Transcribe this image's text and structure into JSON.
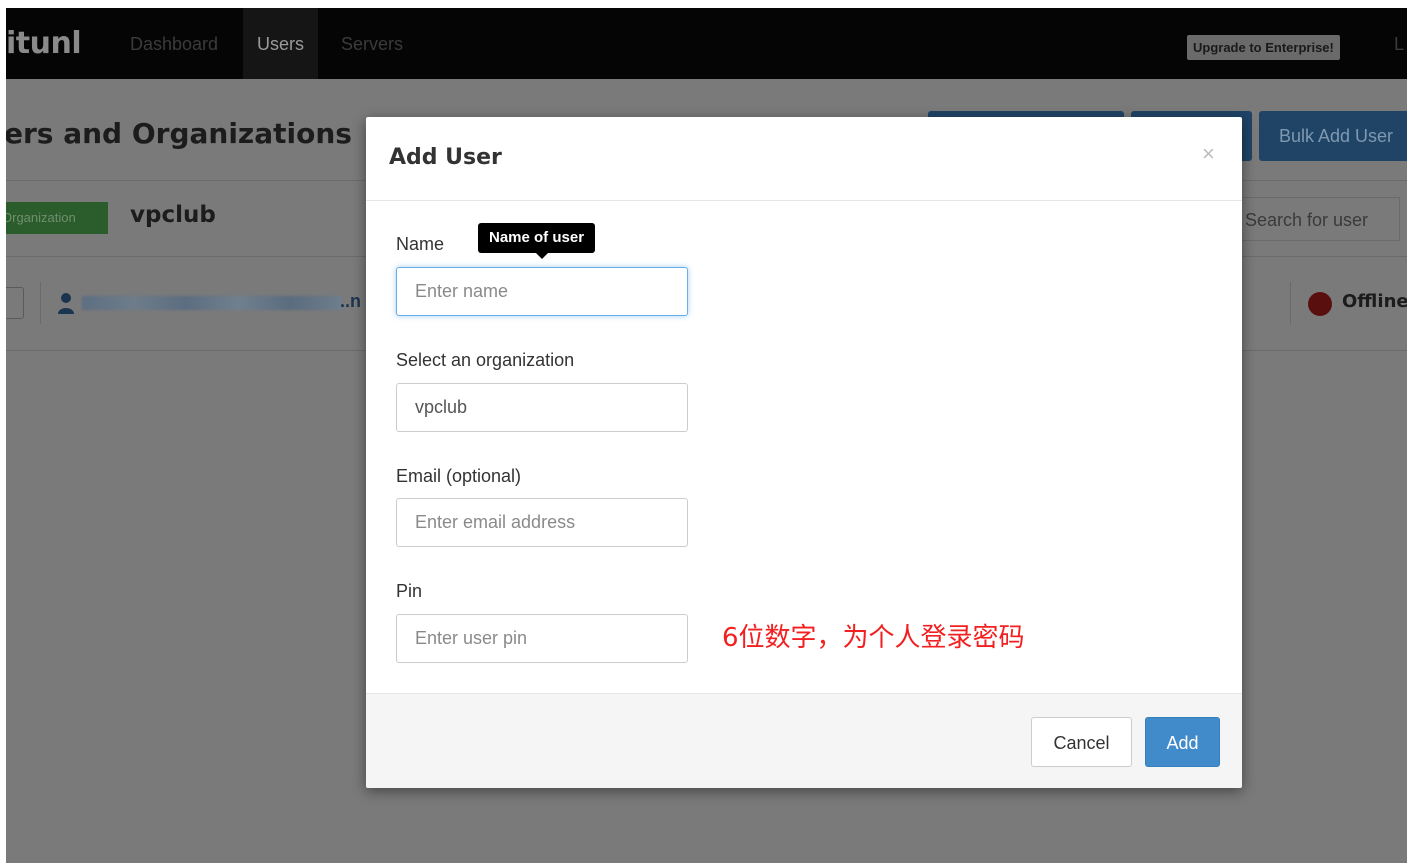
{
  "navbar": {
    "brand": "itunl",
    "links": [
      "Dashboard",
      "Users",
      "Servers"
    ],
    "active": "Users",
    "upgrade_label": "Upgrade to Enterprise!",
    "cut_link": "L"
  },
  "page": {
    "title": "ers and Organizations",
    "bulk_add_label": "Bulk Add User",
    "org_badge": "Organization",
    "org_name": "vpclub",
    "search_placeholder": "Search for user",
    "user_row": {
      "name_tail": "..n",
      "status": "Offline"
    }
  },
  "modal": {
    "title": "Add User",
    "close": "×",
    "tooltip": "Name of user",
    "name": {
      "label": "Name",
      "placeholder": "Enter name"
    },
    "organization": {
      "label": "Select an organization",
      "value": "vpclub"
    },
    "email": {
      "label": "Email (optional)",
      "placeholder": "Enter email address"
    },
    "pin": {
      "label": "Pin",
      "placeholder": "Enter user pin"
    },
    "annotation": "6位数字，为个人登录密码",
    "cancel_label": "Cancel",
    "add_label": "Add"
  },
  "colors": {
    "primary": "#428bca",
    "annotation": "#f22020",
    "offline": "#c9302c"
  }
}
